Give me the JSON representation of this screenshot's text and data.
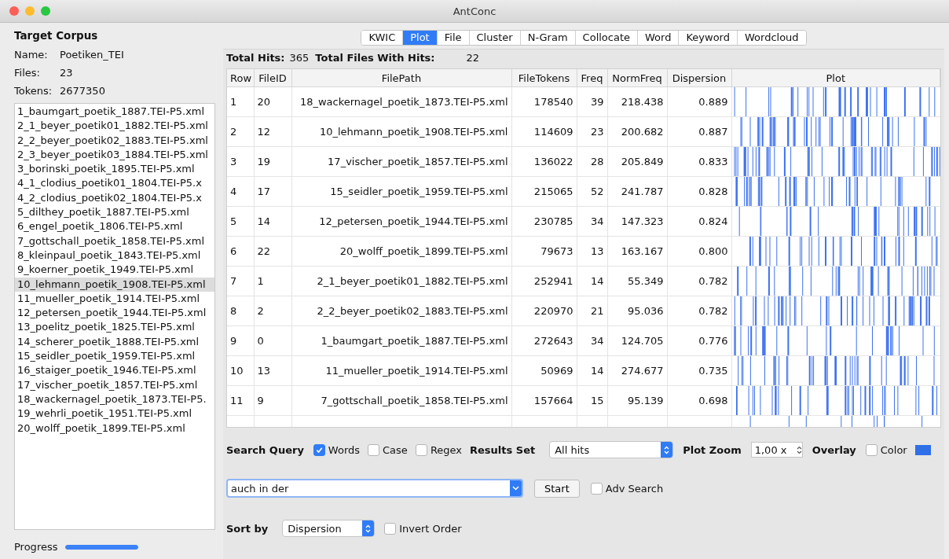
{
  "window": {
    "title": "AntConc"
  },
  "corpus": {
    "heading": "Target Corpus",
    "fields": [
      {
        "label": "Name:",
        "value": "Poetiken_TEI"
      },
      {
        "label": "Files:",
        "value": "23"
      },
      {
        "label": "Tokens:",
        "value": "2677350"
      }
    ],
    "files": [
      {
        "name": "1_baumgart_poetik_1887.TEI-P5.xml",
        "selected": false
      },
      {
        "name": "2_1_beyer_poetik01_1882.TEI-P5.xml",
        "selected": false
      },
      {
        "name": "2_2_beyer_poetik02_1883.TEI-P5.xml",
        "selected": false
      },
      {
        "name": "2_3_beyer_poetik03_1884.TEI-P5.xml",
        "selected": false
      },
      {
        "name": "3_borinski_poetik_1895.TEI-P5.xml",
        "selected": false
      },
      {
        "name": "4_1_clodius_poetik01_1804.TEI-P5.x",
        "selected": false
      },
      {
        "name": "4_2_clodius_poetik02_1804.TEI-P5.x",
        "selected": false
      },
      {
        "name": "5_dilthey_poetik_1887.TEI-P5.xml",
        "selected": false
      },
      {
        "name": "6_engel_poetik_1806.TEI-P5.xml",
        "selected": false
      },
      {
        "name": "7_gottschall_poetik_1858.TEI-P5.xml",
        "selected": false
      },
      {
        "name": "8_kleinpaul_poetik_1843.TEI-P5.xml",
        "selected": false
      },
      {
        "name": "9_koerner_poetik_1949.TEI-P5.xml",
        "selected": false
      },
      {
        "name": "10_lehmann_poetik_1908.TEI-P5.xml",
        "selected": true
      },
      {
        "name": "11_mueller_poetik_1914.TEI-P5.xml",
        "selected": false
      },
      {
        "name": "12_petersen_poetik_1944.TEI-P5.xml",
        "selected": false
      },
      {
        "name": "13_poelitz_poetik_1825.TEI-P5.xml",
        "selected": false
      },
      {
        "name": "14_scherer_poetik_1888.TEI-P5.xml",
        "selected": false
      },
      {
        "name": "15_seidler_poetik_1959.TEI-P5.xml",
        "selected": false
      },
      {
        "name": "16_staiger_poetik_1946.TEI-P5.xml",
        "selected": false
      },
      {
        "name": "17_vischer_poetik_1857.TEI-P5.xml",
        "selected": false
      },
      {
        "name": "18_wackernagel_poetik_1873.TEI-P5.",
        "selected": false
      },
      {
        "name": "19_wehrli_poetik_1951.TEI-P5.xml",
        "selected": false
      },
      {
        "name": "20_wolff_poetik_1899.TEI-P5.xml",
        "selected": false
      }
    ],
    "progress": {
      "label": "Progress",
      "level": 1
    }
  },
  "tabs": [
    {
      "label": "KWIC",
      "selected": false
    },
    {
      "label": "Plot",
      "selected": true
    },
    {
      "label": "File",
      "selected": false
    },
    {
      "label": "Cluster",
      "selected": false
    },
    {
      "label": "N-Gram",
      "selected": false
    },
    {
      "label": "Collocate",
      "selected": false
    },
    {
      "label": "Word",
      "selected": false
    },
    {
      "label": "Keyword",
      "selected": false
    },
    {
      "label": "Wordcloud",
      "selected": false
    }
  ],
  "summary": {
    "hits_label": "Total Hits:",
    "hits": "365",
    "files_label": "Total Files With Hits:",
    "files": "22"
  },
  "table": {
    "columns": [
      "Row",
      "FileID",
      "FilePath",
      "FileTokens",
      "Freq",
      "NormFreq",
      "Dispersion",
      "Plot"
    ],
    "rows": [
      [
        "1",
        "20",
        "18_wackernagel_poetik_1873.TEI-P5.xml",
        "178540",
        "39",
        "218.438",
        "0.889"
      ],
      [
        "2",
        "12",
        "10_lehmann_poetik_1908.TEI-P5.xml",
        "114609",
        "23",
        "200.682",
        "0.887"
      ],
      [
        "3",
        "19",
        "17_vischer_poetik_1857.TEI-P5.xml",
        "136022",
        "28",
        "205.849",
        "0.833"
      ],
      [
        "4",
        "17",
        "15_seidler_poetik_1959.TEI-P5.xml",
        "215065",
        "52",
        "241.787",
        "0.828"
      ],
      [
        "5",
        "14",
        "12_petersen_poetik_1944.TEI-P5.xml",
        "230785",
        "34",
        "147.323",
        "0.824"
      ],
      [
        "6",
        "22",
        "20_wolff_poetik_1899.TEI-P5.xml",
        "79673",
        "13",
        "163.167",
        "0.800"
      ],
      [
        "7",
        "1",
        "2_1_beyer_poetik01_1882.TEI-P5.xml",
        "252941",
        "14",
        "55.349",
        "0.782"
      ],
      [
        "8",
        "2",
        "2_2_beyer_poetik02_1883.TEI-P5.xml",
        "220970",
        "21",
        "95.036",
        "0.782"
      ],
      [
        "9",
        "0",
        "1_baumgart_poetik_1887.TEI-P5.xml",
        "272643",
        "34",
        "124.705",
        "0.776"
      ],
      [
        "10",
        "13",
        "11_mueller_poetik_1914.TEI-P5.xml",
        "50969",
        "14",
        "274.677",
        "0.735"
      ],
      [
        "11",
        "9",
        "7_gottschall_poetik_1858.TEI-P5.xml",
        "157664",
        "15",
        "95.139",
        "0.698"
      ]
    ]
  },
  "options": {
    "query_label": "Search Query",
    "words": {
      "label": "Words",
      "checked": true
    },
    "case": {
      "label": "Case",
      "checked": false
    },
    "regex": {
      "label": "Regex",
      "checked": false
    },
    "results_label": "Results Set",
    "results_value": "All hits",
    "zoom_label": "Plot Zoom",
    "zoom_value": "1,00 x",
    "overlay_label": "Overlay",
    "color": {
      "label": "Color",
      "checked": false
    }
  },
  "search": {
    "value": "auch in der",
    "start": "Start",
    "adv": {
      "label": "Adv Search",
      "checked": false
    }
  },
  "sort": {
    "label": "Sort by",
    "value": "Dispersion",
    "invert": {
      "label": "Invert Order",
      "checked": false
    }
  }
}
